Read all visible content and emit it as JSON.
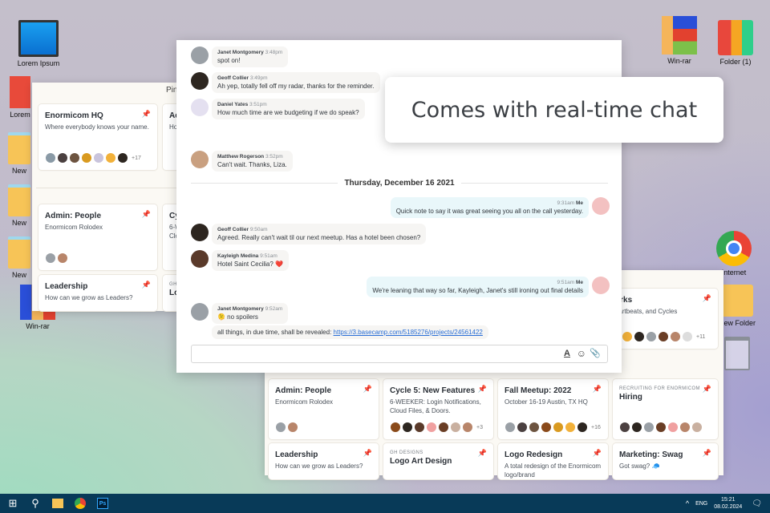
{
  "desktop": {
    "left_icons": [
      "Lorem Ipsum",
      "Lorem",
      "New",
      "New",
      "New",
      "Win-rar"
    ],
    "right_icons": [
      "Win-rar",
      "Folder (1)",
      "Internet",
      "New Folder"
    ]
  },
  "callout": "Comes with real-time chat",
  "left_window": {
    "header": "Pin",
    "cards": [
      {
        "title": "Enormicom HQ",
        "desc": "Where everybody knows your name.",
        "more": "+17"
      },
      {
        "title": "Admin: People",
        "desc": "Enormicom Rolodex"
      },
      {
        "title": "Leadership",
        "desc": "How can we grow as Leaders?"
      },
      {
        "title": "Ad",
        "desc": "How"
      },
      {
        "title": "Cy",
        "desc": "6-W Clo"
      },
      {
        "kicker": "GH",
        "title": "Lo"
      }
    ]
  },
  "right_window": {
    "top_card": {
      "title": "hat Works",
      "desc": "koffs, Heartbeats, and Cycles",
      "more": "+11"
    },
    "cards": [
      {
        "title": "Admin: People",
        "desc": "Enormicom Rolodex"
      },
      {
        "title": "Cycle 5: New Features",
        "desc": "6-WEEKER: Login Notifications, Cloud Files, & Doors.",
        "more": "+3"
      },
      {
        "title": "Fall Meetup: 2022",
        "desc": "October 16-19 Austin, TX HQ",
        "more": "+16"
      },
      {
        "kicker": "RECRUITING FOR ENORMICOM",
        "title": "Hiring"
      },
      {
        "title": "Leadership",
        "desc": "How can we grow as Leaders?"
      },
      {
        "kicker": "GH DESIGNS",
        "title": "Logo Art Design"
      },
      {
        "title": "Logo Redesign",
        "desc": "A total redesign of the Enormicom logo/brand"
      },
      {
        "title": "Marketing: Swag",
        "desc": "Got swag? 🧢"
      }
    ]
  },
  "chat": {
    "messages": [
      {
        "name": "Janet Montgomery",
        "time": "3:48pm",
        "text": "spot on!"
      },
      {
        "name": "Geoff Collier",
        "time": "3:49pm",
        "text": "Ah yep, totally fell off my radar, thanks for the reminder."
      },
      {
        "name": "Daniel Yates",
        "time": "3:51pm",
        "text": "How much time are we budgeting if we do speak?"
      },
      {
        "name": "Matthew Rogerson",
        "time": "3:52pm",
        "text": "Can't wait. Thanks, Liza."
      },
      {
        "name": "Me",
        "time": "9:31am",
        "text": "Quick note to say it was great seeing you all on the call yesterday."
      },
      {
        "name": "Geoff Collier",
        "time": "9:50am",
        "text": "Agreed. Really can't wait til our next meetup. Has a hotel been chosen?"
      },
      {
        "name": "Kayleigh Medina",
        "time": "9:51am",
        "text": "Hotel Saint Cecilia? ❤️"
      },
      {
        "name": "Me",
        "time": "9:51am",
        "text": "We're leaning that way so far, Kayleigh, Janet's still ironing out final details"
      },
      {
        "name": "Janet Montgomery",
        "time": "9:52am",
        "text": "🫠 no spoilers"
      }
    ],
    "followup": "all things, in due time, shall be revealed: ",
    "link": "https://3.basecamp.com/5185276/projects/24561422",
    "date_divider": "Thursday, December 16 2021"
  },
  "taskbar": {
    "lang": "ENG",
    "time": "15:21",
    "date": "08.02.2024"
  }
}
